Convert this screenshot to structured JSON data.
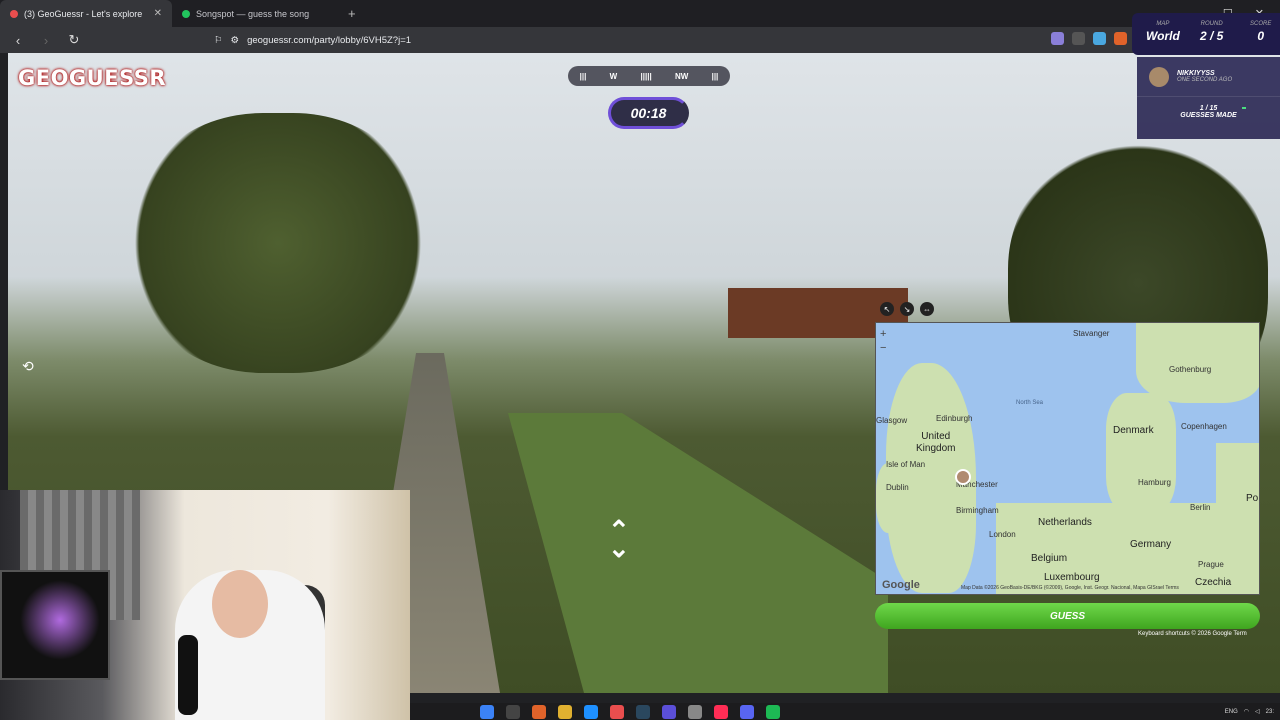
{
  "browser": {
    "tabs": [
      {
        "title": "(3) GeoGuessr - Let's explore",
        "active": true
      },
      {
        "title": "Songspot — guess the song",
        "active": false
      }
    ],
    "url": "geoguessr.com/party/lobby/6VH5Z?j=1"
  },
  "game": {
    "logo": "GEOGUESSR",
    "compass": {
      "left": "W",
      "right": "NW"
    },
    "timer": "00:18",
    "hud": {
      "map_label": "MAP",
      "map_value": "World",
      "round_label": "ROUND",
      "round_value": "2 / 5",
      "score_label": "SCORE",
      "score_value": "0"
    },
    "player": {
      "name": "NIKKIYYSS",
      "time": "ONE SECOND AGO"
    },
    "guesses": {
      "count": "1 / 15",
      "label": "GUESSES MADE"
    },
    "guess_button": "GUESS",
    "keyboard_shortcuts": "Keyboard shortcuts   © 2026 Google   Term"
  },
  "map": {
    "labels": {
      "stavanger": "Stavanger",
      "gothenburg": "Gothenburg",
      "edinburgh": "Edinburgh",
      "north_sea": "North Sea",
      "glasgow": "Glasgow",
      "united_kingdom": "United\nKingdom",
      "denmark": "Denmark",
      "copenhagen": "Copenhagen",
      "isle_of_man": "Isle of Man",
      "manchester": "Manchester",
      "hamburg": "Hamburg",
      "dublin": "Dublin",
      "birmingham": "Birmingham",
      "berlin": "Berlin",
      "netherlands": "Netherlands",
      "london": "London",
      "germany": "Germany",
      "belgium": "Belgium",
      "luxembourg": "Luxembourg",
      "prague": "Prague",
      "czechia": "Czechia",
      "po": "Po"
    },
    "attribution": "Map Data ©2026 GeoBasis-DE/BKG (©2009), Google, Inst. Geogr. Nacional, Mapa GISrael   Terms",
    "google": "Google"
  },
  "taskbar": {
    "tray_lang": "ENG",
    "tray_time": "23:"
  }
}
